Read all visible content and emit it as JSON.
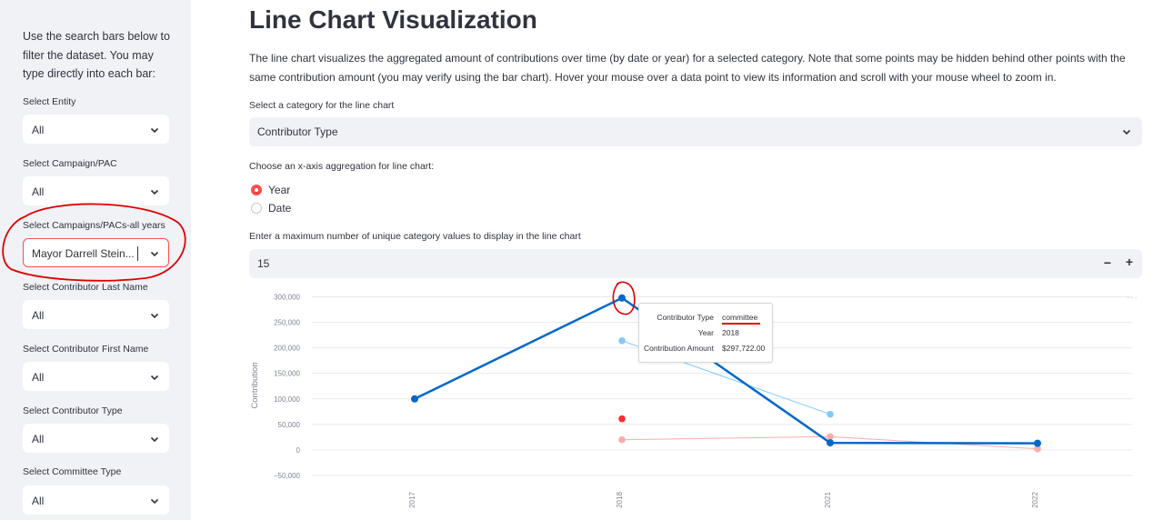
{
  "sidebar": {
    "intro": "Use the search bars below to filter the dataset. You may type directly into each bar:",
    "filters": [
      {
        "label": "Select Entity",
        "value": "All"
      },
      {
        "label": "Select Campaign/PAC",
        "value": "All"
      },
      {
        "label": "Select Campaigns/PACs-all years",
        "value": "Mayor Darrell Stein..."
      },
      {
        "label": "Select Contributor Last Name",
        "value": "All"
      },
      {
        "label": "Select Contributor First Name",
        "value": "All"
      },
      {
        "label": "Select Contributor Type",
        "value": "All"
      },
      {
        "label": "Select Committee Type",
        "value": "All"
      }
    ]
  },
  "main": {
    "title": "Line Chart Visualization",
    "description": "The line chart visualizes the aggregated amount of contributions over time (by date or year) for a selected category. Note that some points may be hidden behind other points with the same contribution amount (you may verify using the bar chart). Hover your mouse over a data point to view its information and scroll with your mouse wheel to zoom in.",
    "category_label": "Select a category for the line chart",
    "category_value": "Contributor Type",
    "aggregation_label": "Choose an x-axis aggregation for line chart:",
    "aggregation_options": [
      "Year",
      "Date"
    ],
    "aggregation_selected": "Year",
    "max_label": "Enter a maximum number of unique category values to display in the line chart",
    "max_value": "15",
    "minus": "−",
    "plus": "+",
    "menu_dots": "···"
  },
  "tooltip": {
    "rows": [
      {
        "key": "Contributor Type",
        "value": "committee"
      },
      {
        "key": "Year",
        "value": "2018"
      },
      {
        "key": "Contribution Amount",
        "value": "$297,722.00"
      }
    ]
  },
  "colors": {
    "accent": "#ff4b4b",
    "annotation": "#e00000",
    "sidebar_bg": "#f0f2f6"
  },
  "chart_data": {
    "type": "line",
    "ylabel": "Contribution",
    "xlabel": "",
    "ylim": [
      -60000,
      310000
    ],
    "yticks": [
      300000,
      250000,
      200000,
      150000,
      100000,
      50000,
      0,
      -50000
    ],
    "ytick_labels": [
      "300,000",
      "250,000",
      "200,000",
      "150,000",
      "100,000",
      "50,000",
      "0",
      "−50,000"
    ],
    "x": [
      "2017",
      "2018",
      "2021",
      "2022"
    ],
    "grid": true,
    "series": [
      {
        "color": "#0068c9",
        "width": 2.5,
        "points": [
          [
            2017,
            100000
          ],
          [
            2018,
            297722
          ],
          [
            2021,
            14000
          ],
          [
            2022,
            13000
          ]
        ]
      },
      {
        "color": "#83c9ff",
        "width": 1,
        "points": [
          [
            2018,
            214000
          ],
          [
            2021,
            70000
          ]
        ]
      },
      {
        "color": "#ffabab",
        "width": 1,
        "points": [
          [
            2018,
            20000
          ],
          [
            2021,
            26000
          ],
          [
            2022,
            2000
          ]
        ]
      },
      {
        "color": "#ff2b2b",
        "width": 1,
        "points": [
          [
            2018,
            61000
          ]
        ]
      }
    ]
  }
}
